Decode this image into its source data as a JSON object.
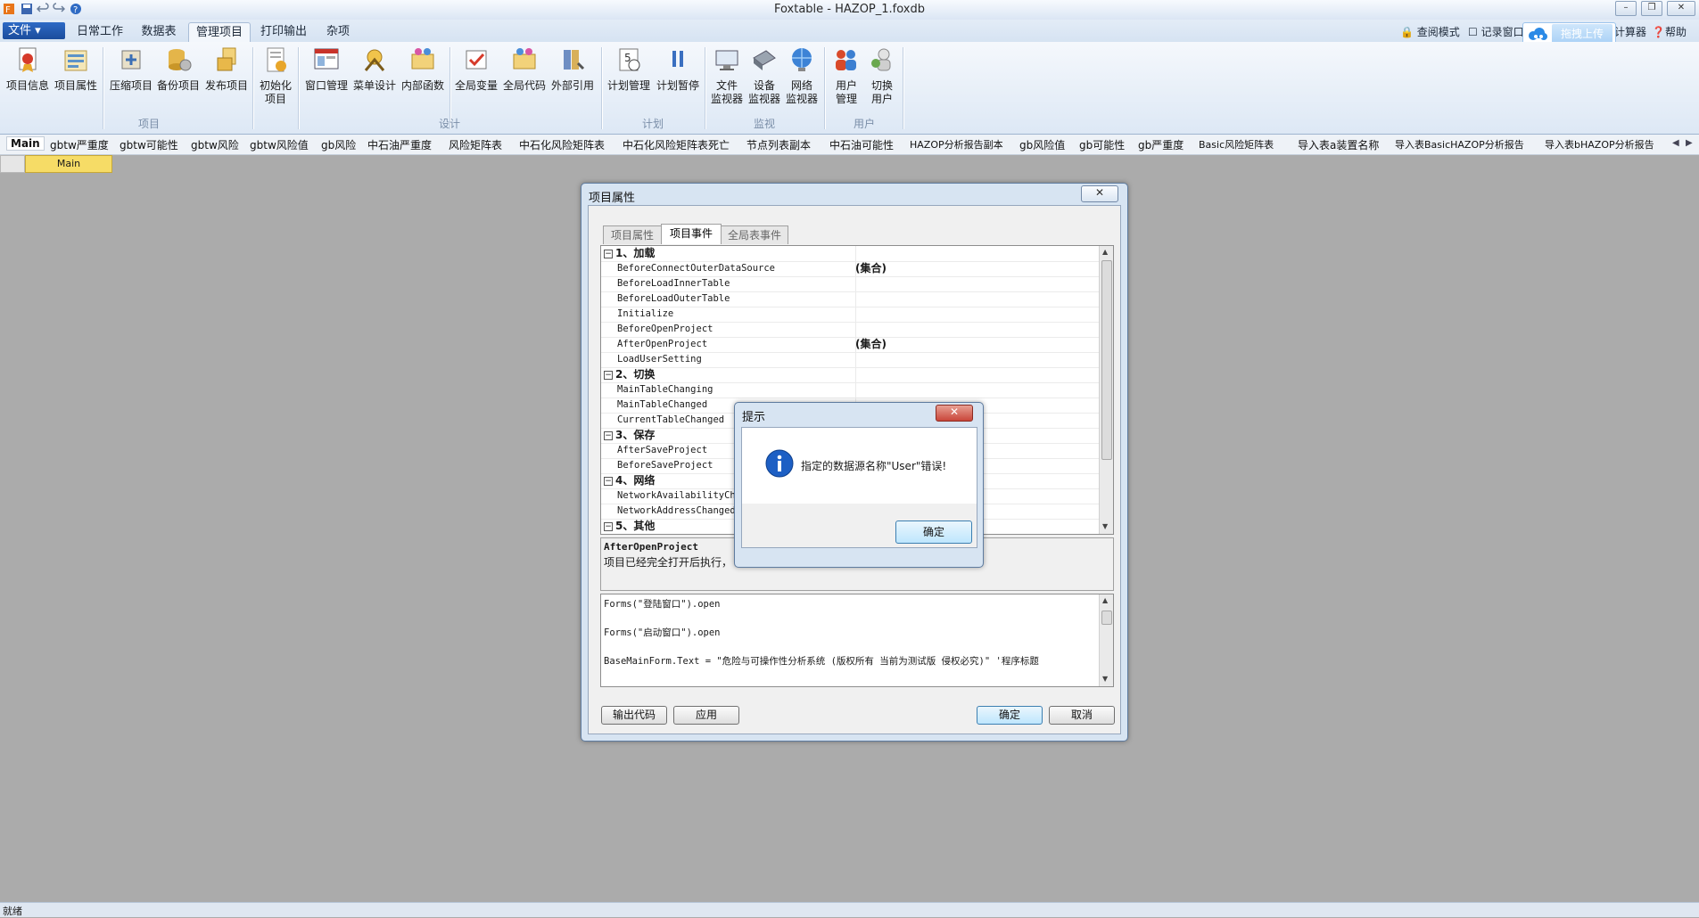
{
  "app": {
    "title": "Foxtable - HAZOP_1.foxdb",
    "file_menu": "文件",
    "tabs": [
      "日常工作",
      "数据表",
      "管理项目",
      "打印输出",
      "杂项"
    ],
    "active_tab": "管理项目",
    "right_menu": [
      "查阅模式",
      "记录窗口",
      "计算器",
      "帮助"
    ],
    "upload_label": "拖拽上传"
  },
  "ribbon": {
    "buttons": [
      {
        "label": "项目信息",
        "icon": "project-info-icon"
      },
      {
        "label": "项目属性",
        "icon": "project-properties-icon"
      },
      {
        "label": "压缩项目",
        "icon": "compress-icon"
      },
      {
        "label": "备份项目",
        "icon": "backup-icon"
      },
      {
        "label": "发布项目",
        "icon": "publish-icon"
      },
      {
        "label": "初始化",
        "label2": "项目",
        "icon": "initialize-icon"
      },
      {
        "label": "窗口管理",
        "icon": "window-manage-icon"
      },
      {
        "label": "菜单设计",
        "icon": "menu-design-icon"
      },
      {
        "label": "内部函数",
        "icon": "internal-function-icon"
      },
      {
        "label": "全局变量",
        "icon": "global-variable-icon"
      },
      {
        "label": "全局代码",
        "icon": "global-code-icon"
      },
      {
        "label": "外部引用",
        "icon": "external-reference-icon"
      },
      {
        "label": "计划管理",
        "icon": "schedule-icon"
      },
      {
        "label": "计划暂停",
        "icon": "pause-icon"
      },
      {
        "label": "文件",
        "label2": "监视器",
        "icon": "file-monitor-icon"
      },
      {
        "label": "设备",
        "label2": "监视器",
        "icon": "device-monitor-icon"
      },
      {
        "label": "网络",
        "label2": "监视器",
        "icon": "network-monitor-icon"
      },
      {
        "label": "用户",
        "label2": "管理",
        "icon": "users-icon"
      },
      {
        "label": "切换",
        "label2": "用户",
        "icon": "switch-user-icon"
      }
    ],
    "groups": [
      "项目",
      "设计",
      "计划",
      "监视",
      "用户"
    ]
  },
  "table_tabs": [
    "Main",
    "gbtw严重度",
    "gbtw可能性",
    "gbtw风险",
    "gbtw风险值",
    "gb风险",
    "中石油严重度",
    "风险矩阵表",
    "中石化风险矩阵表",
    "中石化风险矩阵表死亡",
    "节点列表副本",
    "中石油可能性",
    "HAZOP分析报告副本",
    "gb风险值",
    "gb可能性",
    "gb严重度",
    "Basic风险矩阵表",
    "导入表a装置名称",
    "导入表BasicHAZOP分析报告",
    "导入表bHAZOP分析报告"
  ],
  "grid_header": "Main",
  "dialog": {
    "title": "项目属性",
    "close_glyph": "✕",
    "tabs": [
      "项目属性",
      "项目事件",
      "全局表事件"
    ],
    "active_tab": "项目事件",
    "rows": [
      {
        "type": "cat",
        "name": "1、加载",
        "value": ""
      },
      {
        "type": "item",
        "name": "BeforeConnectOuterDataSource",
        "value": "(集合)"
      },
      {
        "type": "item",
        "name": "BeforeLoadInnerTable",
        "value": ""
      },
      {
        "type": "item",
        "name": "BeforeLoadOuterTable",
        "value": ""
      },
      {
        "type": "item",
        "name": "Initialize",
        "value": ""
      },
      {
        "type": "item",
        "name": "BeforeOpenProject",
        "value": ""
      },
      {
        "type": "item",
        "name": "AfterOpenProject",
        "value": "(集合)"
      },
      {
        "type": "item",
        "name": "LoadUserSetting",
        "value": ""
      },
      {
        "type": "cat",
        "name": "2、切换",
        "value": ""
      },
      {
        "type": "item",
        "name": "MainTableChanging",
        "value": ""
      },
      {
        "type": "item",
        "name": "MainTableChanged",
        "value": ""
      },
      {
        "type": "item",
        "name": "CurrentTableChanged",
        "value": ""
      },
      {
        "type": "cat",
        "name": "3、保存",
        "value": ""
      },
      {
        "type": "item",
        "name": "AfterSaveProject",
        "value": ""
      },
      {
        "type": "item",
        "name": "BeforeSaveProject",
        "value": ""
      },
      {
        "type": "cat",
        "name": "4、网络",
        "value": ""
      },
      {
        "type": "item",
        "name": "NetworkAvailabilityChan",
        "value": ""
      },
      {
        "type": "item",
        "name": "NetworkAddressChanged",
        "value": ""
      },
      {
        "type": "cat",
        "name": "5、其他",
        "value": ""
      }
    ],
    "description_title": "AfterOpenProject",
    "description_text": "项目已经完全打开后执行，",
    "code_lines": [
      "Forms(\"登陆窗口\").open",
      "",
      "Forms(\"启动窗口\").open",
      "",
      "BaseMainForm.Text = \"危险与可操作性分析系统 (版权所有 当前为测试版 侵权必究)\" '程序标题"
    ],
    "buttons": {
      "export": "输出代码",
      "apply": "应用",
      "ok": "确定",
      "cancel": "取消"
    }
  },
  "message_box": {
    "title": "提示",
    "close_glyph": "✕",
    "message": "指定的数据源名称\"User\"错误!",
    "ok": "确定"
  },
  "statusbar": {
    "text": "就绪"
  },
  "colors": {
    "desktop": "#ababab",
    "ribbon": "#dde8f5",
    "main_header": "#f6dc66",
    "file_button": "#1b4c9c",
    "close_red": "#c9463a"
  }
}
